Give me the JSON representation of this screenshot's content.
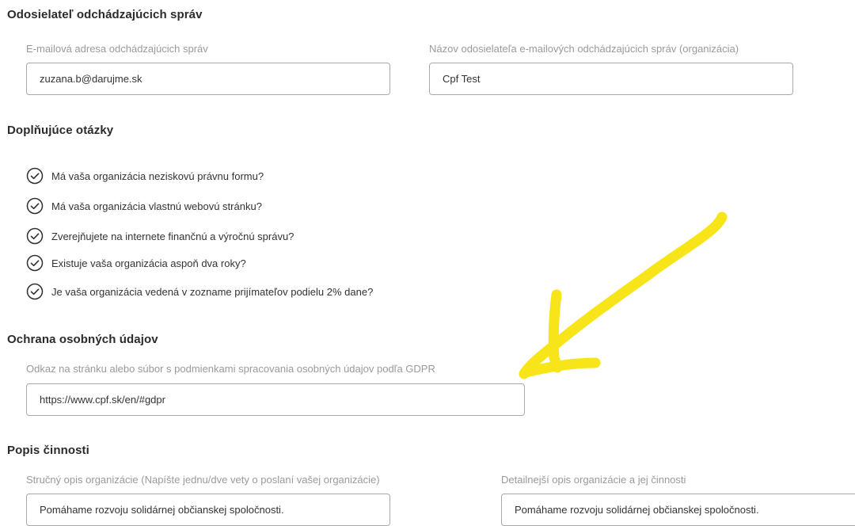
{
  "sender": {
    "title": "Odosielateľ odchádzajúcich správ",
    "email_label": "E-mailová adresa odchádzajúcich správ",
    "email_value": "zuzana.b@darujme.sk",
    "name_label": "Názov odosielateľa e-mailových odchádzajúcich správ (organizácia)",
    "name_value": "Cpf Test"
  },
  "questions": {
    "title": "Doplňujúce otázky",
    "items": [
      {
        "label": "Má vaša organizácia neziskovú právnu formu?",
        "icon": "check-circle-icon"
      },
      {
        "label": "Má vaša organizácia vlastnú webovú stránku?",
        "icon": "check-circle-icon"
      },
      {
        "label": "Zverejňujete na internete finančnú a výročnú správu?",
        "icon": "check-circle-icon"
      },
      {
        "label": "Existuje vaša organizácia aspoň dva roky?",
        "icon": "check-circle-icon"
      },
      {
        "label": "Je vaša organizácia vedená v zozname prijímateľov podielu 2% dane?",
        "icon": "check-circle-icon"
      }
    ]
  },
  "privacy": {
    "title": "Ochrana osobných údajov",
    "gdpr_label": "Odkaz na stránku alebo súbor s podmienkami spracovania osobných údajov podľa GDPR",
    "gdpr_value": "https://www.cpf.sk/en/#gdpr"
  },
  "activity": {
    "title": "Popis činnosti",
    "short_label": "Stručný opis organizácie (Napíšte jednu/dve vety o poslaní vašej organizácie)",
    "short_value": "Pomáhame rozvoju solidárnej občianskej spoločnosti.",
    "detail_label": "Detailnejší opis organizácie a jej činnosti",
    "detail_value": "Pomáhame rozvoju solidárnej občianskej spoločnosti."
  },
  "annotation": {
    "color": "#f7e51a",
    "icon": "arrow-annotation-icon"
  }
}
